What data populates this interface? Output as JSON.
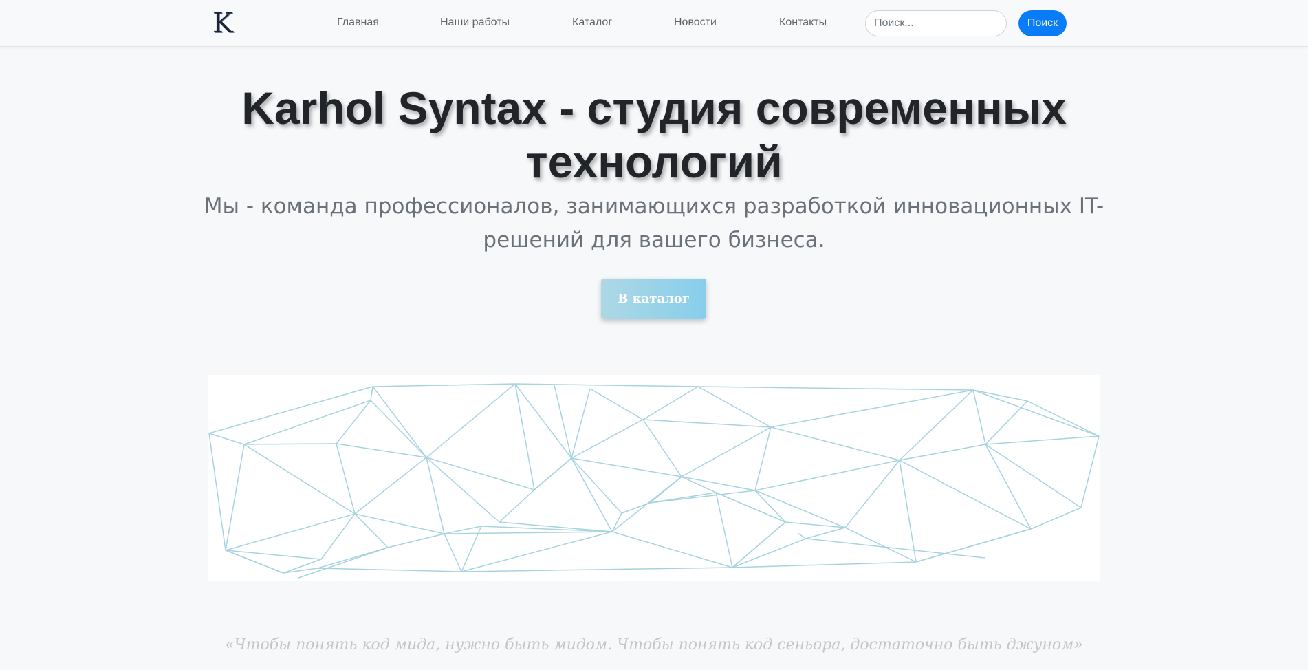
{
  "navbar": {
    "logo_letter": "K",
    "links": [
      "Главная",
      "Наши работы",
      "Каталог",
      "Новости",
      "Контакты"
    ],
    "search_placeholder": "Поиск...",
    "search_button": "Поиск"
  },
  "hero": {
    "title": "Karhol Syntax - студия современных технологий",
    "subtitle": "Мы - команда профессионалов, занимающихся разработкой инновационных IT-решений для вашего бизнеса.",
    "cta_button": "В каталог"
  },
  "quote": "«Чтобы понять код мида, нужно быть мидом. Чтобы понять код сеньора, достаточно быть джуном»",
  "colors": {
    "accent": "#0a7cf8",
    "mesh_stroke": "#a7d3e0",
    "cta_gradient_start": "#add8e6",
    "cta_gradient_end": "#87ceeb"
  }
}
